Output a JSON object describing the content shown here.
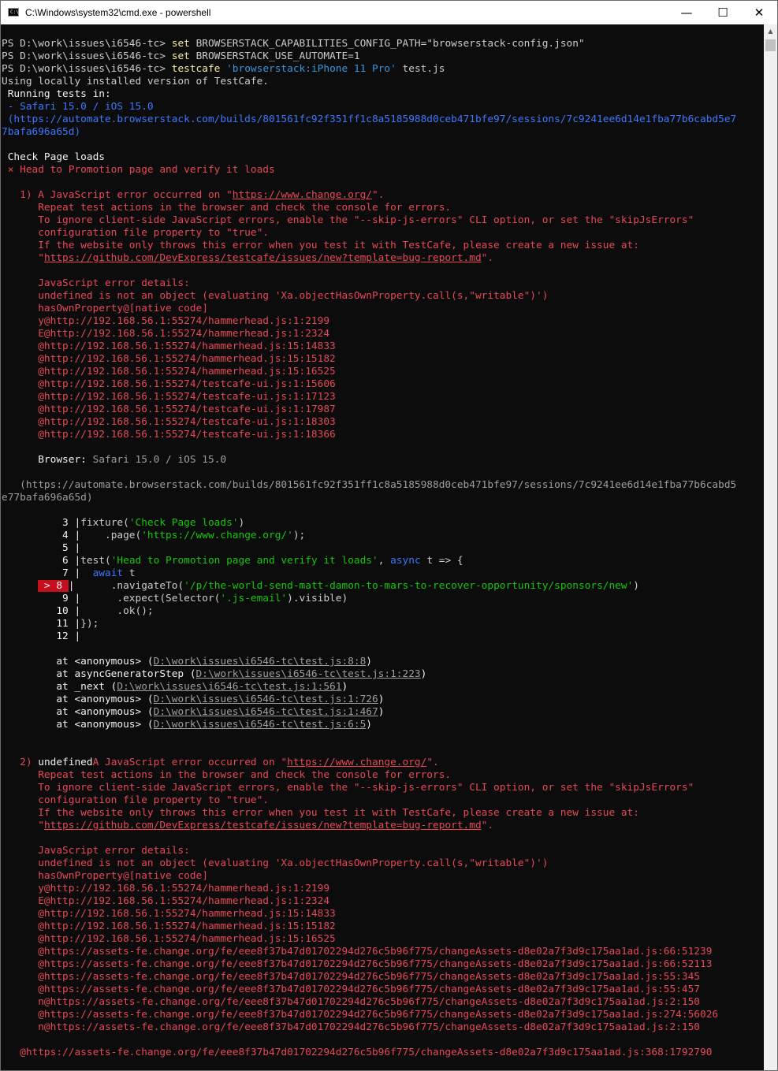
{
  "window": {
    "title": "C:\\Windows\\system32\\cmd.exe - powershell",
    "icon_label": "C:\\",
    "minimize": "—",
    "maximize": "☐",
    "close": "✕",
    "scroll_up": "▲"
  },
  "lines": [
    [
      {
        "t": "PS D:\\work\\issues\\i6546-tc> ",
        "c": "fg"
      },
      {
        "t": "set",
        "c": "yel"
      },
      {
        "t": " BROWSERSTACK_CAPABILITIES_CONFIG_PATH=\"browserstack-config.json\"",
        "c": "fg"
      }
    ],
    [
      {
        "t": "PS D:\\work\\issues\\i6546-tc> ",
        "c": "fg"
      },
      {
        "t": "set",
        "c": "yel"
      },
      {
        "t": " BROWSERSTACK_USE_AUTOMATE=1",
        "c": "fg"
      }
    ],
    [
      {
        "t": "PS D:\\work\\issues\\i6546-tc> ",
        "c": "fg"
      },
      {
        "t": "testcafe",
        "c": "yel"
      },
      {
        "t": " ",
        "c": "fg"
      },
      {
        "t": "'browserstack:iPhone 11 Pro'",
        "c": "cy"
      },
      {
        "t": " test.js",
        "c": "fg"
      }
    ],
    [
      {
        "t": "Using locally installed version of TestCafe.",
        "c": "fg"
      }
    ],
    [
      {
        "t": " Running tests in:",
        "c": "wh"
      }
    ],
    [
      {
        "t": " - Safari 15.0 / iOS 15.0",
        "c": "blue"
      }
    ],
    [
      {
        "t": " (https://automate.browserstack.com/builds/801561fc92f351ff1c8a5185988d0ceb471bfe97/sessions/7c9241ee6d14e1fba77b6cabd5e7",
        "c": "blue"
      }
    ],
    [
      {
        "t": "7bafa696a65d)",
        "c": "blue"
      }
    ],
    [],
    [
      {
        "t": " Check Page loads",
        "c": "wh"
      }
    ],
    [
      {
        "t": " × Head to Promotion page and verify it loads",
        "c": "red"
      }
    ],
    [],
    [
      {
        "t": "   1) A JavaScript error occurred on \"",
        "c": "red"
      },
      {
        "t": "https://www.change.org/",
        "c": "red u"
      },
      {
        "t": "\".",
        "c": "red"
      }
    ],
    [
      {
        "t": "      Repeat test actions in the browser and check the console for errors.",
        "c": "red"
      }
    ],
    [
      {
        "t": "      To ignore client-side JavaScript errors, enable the \"--skip-js-errors\" CLI option, or set the \"skipJsErrors\"",
        "c": "red"
      }
    ],
    [
      {
        "t": "      configuration file property to \"true\".",
        "c": "red"
      }
    ],
    [
      {
        "t": "      If the website only throws this error when you test it with TestCafe, please create a new issue at:",
        "c": "red"
      }
    ],
    [
      {
        "t": "      \"",
        "c": "red"
      },
      {
        "t": "https://github.com/DevExpress/testcafe/issues/new?template=bug-report.md",
        "c": "red u"
      },
      {
        "t": "\".",
        "c": "red"
      }
    ],
    [],
    [
      {
        "t": "      JavaScript error details:",
        "c": "red"
      }
    ],
    [
      {
        "t": "      undefined is not an object (evaluating 'Xa.objectHasOwnProperty.call(s,\"writable\")')",
        "c": "red"
      }
    ],
    [
      {
        "t": "      hasOwnProperty@[native code]",
        "c": "red"
      }
    ],
    [
      {
        "t": "      y@http://192.168.56.1:55274/hammerhead.js:1:2199",
        "c": "red"
      }
    ],
    [
      {
        "t": "      E@http://192.168.56.1:55274/hammerhead.js:1:2324",
        "c": "red"
      }
    ],
    [
      {
        "t": "      @http://192.168.56.1:55274/hammerhead.js:15:14833",
        "c": "red"
      }
    ],
    [
      {
        "t": "      @http://192.168.56.1:55274/hammerhead.js:15:15182",
        "c": "red"
      }
    ],
    [
      {
        "t": "      @http://192.168.56.1:55274/hammerhead.js:15:16525",
        "c": "red"
      }
    ],
    [
      {
        "t": "      @http://192.168.56.1:55274/testcafe-ui.js:1:15606",
        "c": "red"
      }
    ],
    [
      {
        "t": "      @http://192.168.56.1:55274/testcafe-ui.js:1:17123",
        "c": "red"
      }
    ],
    [
      {
        "t": "      @http://192.168.56.1:55274/testcafe-ui.js:1:17987",
        "c": "red"
      }
    ],
    [
      {
        "t": "      @http://192.168.56.1:55274/testcafe-ui.js:1:18303",
        "c": "red"
      }
    ],
    [
      {
        "t": "      @http://192.168.56.1:55274/testcafe-ui.js:1:18366",
        "c": "red"
      }
    ],
    [],
    [
      {
        "t": "      Browser: ",
        "c": "wh"
      },
      {
        "t": "Safari 15.0 / iOS 15.0",
        "c": "grey"
      }
    ],
    [],
    [
      {
        "t": "   (https://automate.browserstack.com/builds/801561fc92f351ff1c8a5185988d0ceb471bfe97/sessions/7c9241ee6d14e1fba77b6cabd5",
        "c": "grey"
      }
    ],
    [
      {
        "t": "e77bafa696a65d)",
        "c": "grey"
      }
    ],
    [],
    [
      {
        "t": "          3 |",
        "c": "wh"
      },
      {
        "t": "fixture(",
        "c": "fg"
      },
      {
        "t": "'Check Page loads'",
        "c": "green"
      },
      {
        "t": ")",
        "c": "fg"
      }
    ],
    [
      {
        "t": "          4 |",
        "c": "wh"
      },
      {
        "t": "    .page(",
        "c": "fg"
      },
      {
        "t": "'https://www.change.org/'",
        "c": "green"
      },
      {
        "t": ");",
        "c": "fg"
      }
    ],
    [
      {
        "t": "          5 |",
        "c": "wh"
      }
    ],
    [
      {
        "t": "          6 |",
        "c": "wh"
      },
      {
        "t": "test(",
        "c": "fg"
      },
      {
        "t": "'Head to Promotion page and verify it loads'",
        "c": "green"
      },
      {
        "t": ", ",
        "c": "fg"
      },
      {
        "t": "async",
        "c": "blue"
      },
      {
        "t": " t => {",
        "c": "fg"
      }
    ],
    [
      {
        "t": "          7 |",
        "c": "wh"
      },
      {
        "t": "  ",
        "c": "fg"
      },
      {
        "t": "await",
        "c": "blue"
      },
      {
        "t": " t",
        "c": "fg"
      }
    ],
    [
      {
        "t": "      ",
        "c": "fg"
      },
      {
        "t": " > 8 ",
        "c": "marker"
      },
      {
        "t": "|",
        "c": "wh"
      },
      {
        "t": "      .navigateTo(",
        "c": "fg"
      },
      {
        "t": "'/p/the-world-send-matt-damon-to-mars-to-recover-opportunity/sponsors/new'",
        "c": "green"
      },
      {
        "t": ")",
        "c": "fg"
      }
    ],
    [
      {
        "t": "          9 |",
        "c": "wh"
      },
      {
        "t": "      .expect(Selector(",
        "c": "fg"
      },
      {
        "t": "'.js-email'",
        "c": "green"
      },
      {
        "t": ").visible)",
        "c": "fg"
      }
    ],
    [
      {
        "t": "         10 |",
        "c": "wh"
      },
      {
        "t": "      .ok();",
        "c": "fg"
      }
    ],
    [
      {
        "t": "         11 |",
        "c": "wh"
      },
      {
        "t": "});",
        "c": "fg"
      }
    ],
    [
      {
        "t": "         12 |",
        "c": "wh"
      }
    ],
    [],
    [
      {
        "t": "         at <anonymous> (",
        "c": "wh"
      },
      {
        "t": "D:\\work\\issues\\i6546-tc\\test.js:8:8",
        "c": "grey u"
      },
      {
        "t": ")",
        "c": "wh"
      }
    ],
    [
      {
        "t": "         at asyncGeneratorStep (",
        "c": "wh"
      },
      {
        "t": "D:\\work\\issues\\i6546-tc\\test.js:1:223",
        "c": "grey u"
      },
      {
        "t": ")",
        "c": "wh"
      }
    ],
    [
      {
        "t": "         at _next (",
        "c": "wh"
      },
      {
        "t": "D:\\work\\issues\\i6546-tc\\test.js:1:561",
        "c": "grey u"
      },
      {
        "t": ")",
        "c": "wh"
      }
    ],
    [
      {
        "t": "         at <anonymous> (",
        "c": "wh"
      },
      {
        "t": "D:\\work\\issues\\i6546-tc\\test.js:1:726",
        "c": "grey u"
      },
      {
        "t": ")",
        "c": "wh"
      }
    ],
    [
      {
        "t": "         at <anonymous> (",
        "c": "wh"
      },
      {
        "t": "D:\\work\\issues\\i6546-tc\\test.js:1:467",
        "c": "grey u"
      },
      {
        "t": ")",
        "c": "wh"
      }
    ],
    [
      {
        "t": "         at <anonymous> (",
        "c": "wh"
      },
      {
        "t": "D:\\work\\issues\\i6546-tc\\test.js:6:5",
        "c": "grey u"
      },
      {
        "t": ")",
        "c": "wh"
      }
    ],
    [],
    [],
    [
      {
        "t": "   2) ",
        "c": "red"
      },
      {
        "t": "undefined",
        "c": "wh"
      },
      {
        "t": "A JavaScript error occurred on \"",
        "c": "red"
      },
      {
        "t": "https://www.change.org/",
        "c": "red u"
      },
      {
        "t": "\".",
        "c": "red"
      }
    ],
    [
      {
        "t": "      Repeat test actions in the browser and check the console for errors.",
        "c": "red"
      }
    ],
    [
      {
        "t": "      To ignore client-side JavaScript errors, enable the \"--skip-js-errors\" CLI option, or set the \"skipJsErrors\"",
        "c": "red"
      }
    ],
    [
      {
        "t": "      configuration file property to \"true\".",
        "c": "red"
      }
    ],
    [
      {
        "t": "      If the website only throws this error when you test it with TestCafe, please create a new issue at:",
        "c": "red"
      }
    ],
    [
      {
        "t": "      \"",
        "c": "red"
      },
      {
        "t": "https://github.com/DevExpress/testcafe/issues/new?template=bug-report.md",
        "c": "red u"
      },
      {
        "t": "\".",
        "c": "red"
      }
    ],
    [],
    [
      {
        "t": "      JavaScript error details:",
        "c": "red"
      }
    ],
    [
      {
        "t": "      undefined is not an object (evaluating 'Xa.objectHasOwnProperty.call(s,\"writable\")')",
        "c": "red"
      }
    ],
    [
      {
        "t": "      hasOwnProperty@[native code]",
        "c": "red"
      }
    ],
    [
      {
        "t": "      y@http://192.168.56.1:55274/hammerhead.js:1:2199",
        "c": "red"
      }
    ],
    [
      {
        "t": "      E@http://192.168.56.1:55274/hammerhead.js:1:2324",
        "c": "red"
      }
    ],
    [
      {
        "t": "      @http://192.168.56.1:55274/hammerhead.js:15:14833",
        "c": "red"
      }
    ],
    [
      {
        "t": "      @http://192.168.56.1:55274/hammerhead.js:15:15182",
        "c": "red"
      }
    ],
    [
      {
        "t": "      @http://192.168.56.1:55274/hammerhead.js:15:16525",
        "c": "red"
      }
    ],
    [
      {
        "t": "      @https://assets-fe.change.org/fe/eee8f37b47d01702294d276c5b96f775/changeAssets-d8e02a7f3d9c175aa1ad.js:66:51239",
        "c": "red"
      }
    ],
    [
      {
        "t": "      @https://assets-fe.change.org/fe/eee8f37b47d01702294d276c5b96f775/changeAssets-d8e02a7f3d9c175aa1ad.js:66:52113",
        "c": "red"
      }
    ],
    [
      {
        "t": "      @https://assets-fe.change.org/fe/eee8f37b47d01702294d276c5b96f775/changeAssets-d8e02a7f3d9c175aa1ad.js:55:345",
        "c": "red"
      }
    ],
    [
      {
        "t": "      @https://assets-fe.change.org/fe/eee8f37b47d01702294d276c5b96f775/changeAssets-d8e02a7f3d9c175aa1ad.js:55:457",
        "c": "red"
      }
    ],
    [
      {
        "t": "      n@https://assets-fe.change.org/fe/eee8f37b47d01702294d276c5b96f775/changeAssets-d8e02a7f3d9c175aa1ad.js:2:150",
        "c": "red"
      }
    ],
    [
      {
        "t": "      @https://assets-fe.change.org/fe/eee8f37b47d01702294d276c5b96f775/changeAssets-d8e02a7f3d9c175aa1ad.js:274:56026",
        "c": "red"
      }
    ],
    [
      {
        "t": "      n@https://assets-fe.change.org/fe/eee8f37b47d01702294d276c5b96f775/changeAssets-d8e02a7f3d9c175aa1ad.js:2:150",
        "c": "red"
      }
    ],
    [],
    [
      {
        "t": "   @https://assets-fe.change.org/fe/eee8f37b47d01702294d276c5b96f775/changeAssets-d8e02a7f3d9c175aa1ad.js:368:1792790",
        "c": "red"
      }
    ]
  ]
}
